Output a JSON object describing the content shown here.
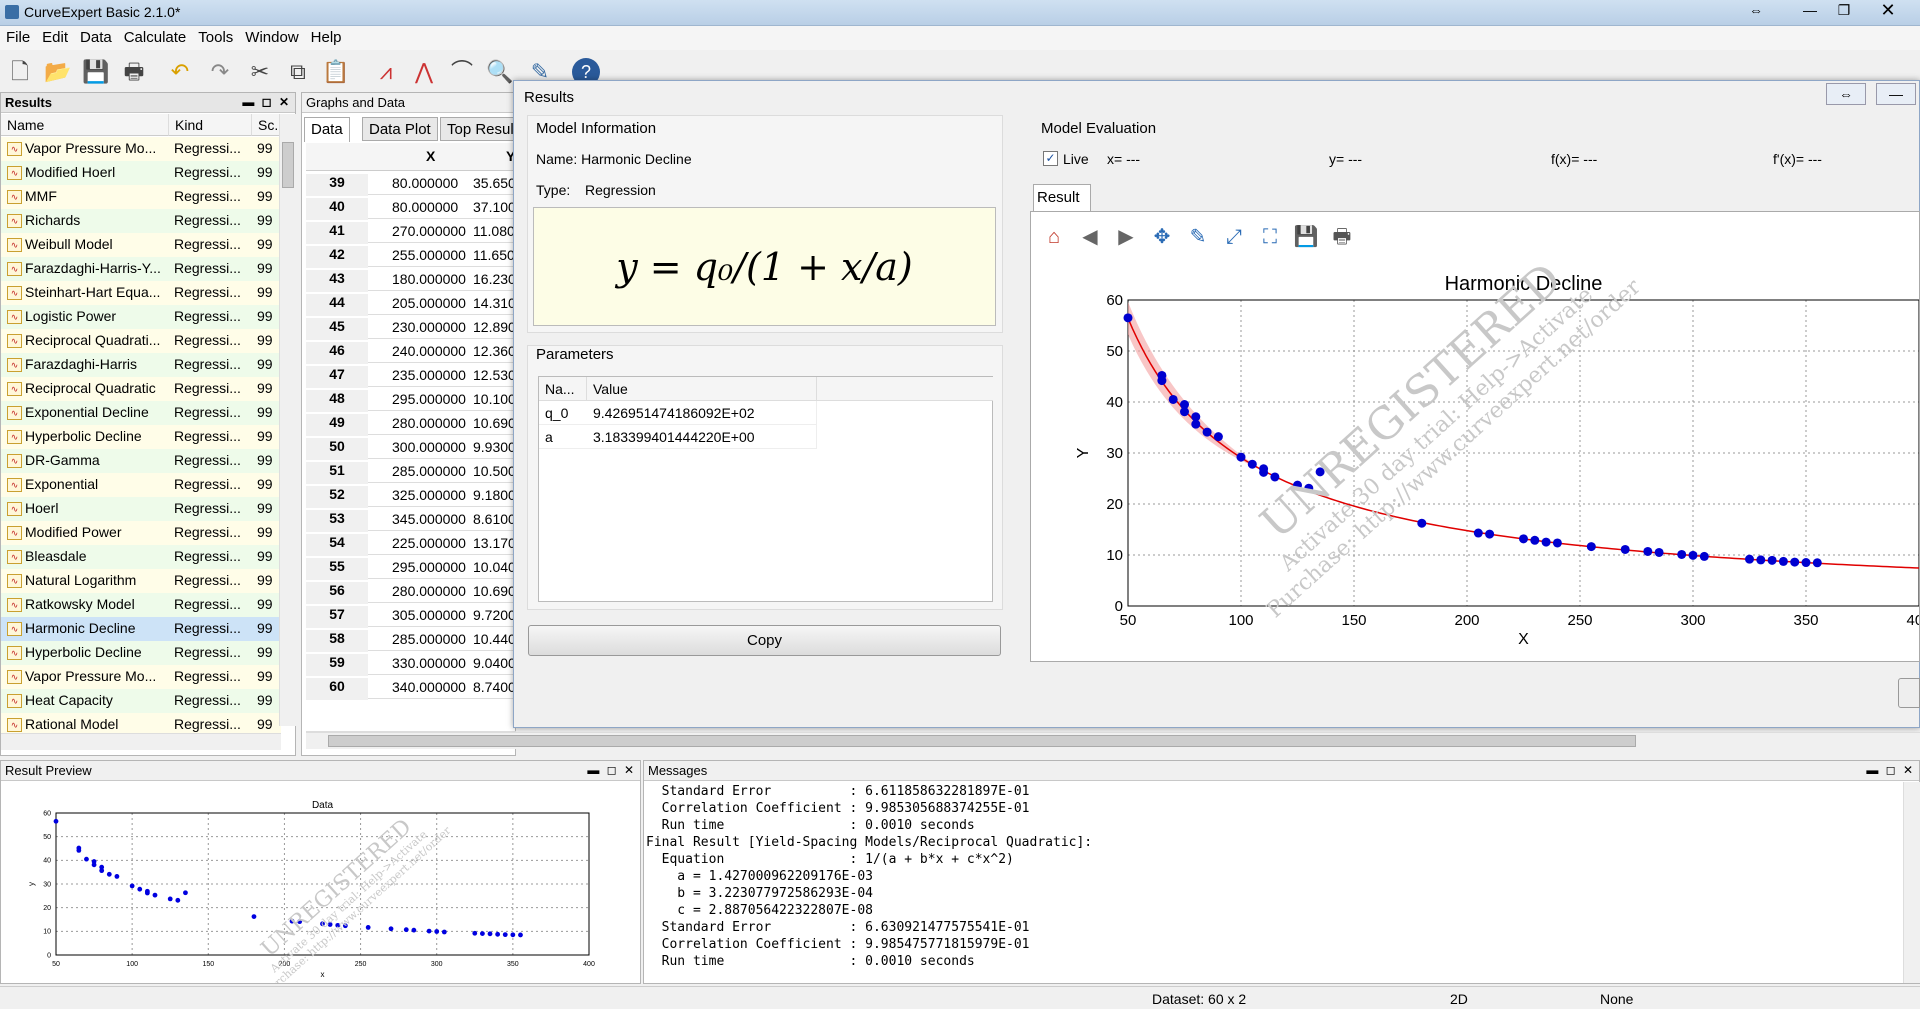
{
  "app": {
    "title": "CurveExpert Basic 2.1.0*"
  },
  "menu": [
    "File",
    "Edit",
    "Data",
    "Calculate",
    "Tools",
    "Window",
    "Help"
  ],
  "toolbar": [
    "new-icon",
    "open-icon",
    "save-icon",
    "print-icon",
    "undo-icon",
    "redo-icon",
    "cut-icon",
    "copy-icon",
    "paste-icon",
    "scatter-plot-icon",
    "line-plot-icon",
    "curve-plot-icon",
    "zoom-icon",
    "edit-icon",
    "help-icon"
  ],
  "left": {
    "title": "Results",
    "cols": [
      "Name",
      "Kind",
      "Sc."
    ],
    "rows": [
      {
        "name": "Vapor Pressure Mo...",
        "kind": "Regressi...",
        "sc": "99"
      },
      {
        "name": "Modified Hoerl",
        "kind": "Regressi...",
        "sc": "99"
      },
      {
        "name": "MMF",
        "kind": "Regressi...",
        "sc": "99"
      },
      {
        "name": "Richards",
        "kind": "Regressi...",
        "sc": "99"
      },
      {
        "name": "Weibull Model",
        "kind": "Regressi...",
        "sc": "99"
      },
      {
        "name": "Farazdaghi-Harris-Y...",
        "kind": "Regressi...",
        "sc": "99"
      },
      {
        "name": "Steinhart-Hart Equa...",
        "kind": "Regressi...",
        "sc": "99"
      },
      {
        "name": "Logistic Power",
        "kind": "Regressi...",
        "sc": "99"
      },
      {
        "name": "Reciprocal Quadrati...",
        "kind": "Regressi...",
        "sc": "99"
      },
      {
        "name": "Farazdaghi-Harris",
        "kind": "Regressi...",
        "sc": "99"
      },
      {
        "name": "Reciprocal Quadratic",
        "kind": "Regressi...",
        "sc": "99"
      },
      {
        "name": "Exponential Decline",
        "kind": "Regressi...",
        "sc": "99"
      },
      {
        "name": "Hyperbolic Decline",
        "kind": "Regressi...",
        "sc": "99"
      },
      {
        "name": "DR-Gamma",
        "kind": "Regressi...",
        "sc": "99"
      },
      {
        "name": "Exponential",
        "kind": "Regressi...",
        "sc": "99"
      },
      {
        "name": "Hoerl",
        "kind": "Regressi...",
        "sc": "99"
      },
      {
        "name": "Modified Power",
        "kind": "Regressi...",
        "sc": "99"
      },
      {
        "name": "Bleasdale",
        "kind": "Regressi...",
        "sc": "99"
      },
      {
        "name": "Natural Logarithm",
        "kind": "Regressi...",
        "sc": "99"
      },
      {
        "name": "Ratkowsky Model",
        "kind": "Regressi...",
        "sc": "99"
      },
      {
        "name": "Harmonic Decline",
        "kind": "Regressi...",
        "sc": "99"
      },
      {
        "name": "Hyperbolic Decline",
        "kind": "Regressi...",
        "sc": "99"
      },
      {
        "name": "Vapor Pressure Mo...",
        "kind": "Regressi...",
        "sc": "99"
      },
      {
        "name": "Heat Capacity",
        "kind": "Regressi...",
        "sc": "99"
      },
      {
        "name": "Rational Model",
        "kind": "Regressi...",
        "sc": "99"
      }
    ]
  },
  "graphs": {
    "title": "Graphs and Data",
    "tabs": [
      "Data",
      "Data Plot",
      "Top Result"
    ],
    "cols": [
      "X",
      "Y"
    ],
    "rows": [
      {
        "n": "39",
        "x": "80.000000",
        "y": "35.650"
      },
      {
        "n": "40",
        "x": "80.000000",
        "y": "37.100"
      },
      {
        "n": "41",
        "x": "270.000000",
        "y": "11.080"
      },
      {
        "n": "42",
        "x": "255.000000",
        "y": "11.650"
      },
      {
        "n": "43",
        "x": "180.000000",
        "y": "16.230"
      },
      {
        "n": "44",
        "x": "205.000000",
        "y": "14.310"
      },
      {
        "n": "45",
        "x": "230.000000",
        "y": "12.890"
      },
      {
        "n": "46",
        "x": "240.000000",
        "y": "12.360"
      },
      {
        "n": "47",
        "x": "235.000000",
        "y": "12.530"
      },
      {
        "n": "48",
        "x": "295.000000",
        "y": "10.100"
      },
      {
        "n": "49",
        "x": "280.000000",
        "y": "10.690"
      },
      {
        "n": "50",
        "x": "300.000000",
        "y": "9.9300"
      },
      {
        "n": "51",
        "x": "285.000000",
        "y": "10.500"
      },
      {
        "n": "52",
        "x": "325.000000",
        "y": "9.1800"
      },
      {
        "n": "53",
        "x": "345.000000",
        "y": "8.6100"
      },
      {
        "n": "54",
        "x": "225.000000",
        "y": "13.170"
      },
      {
        "n": "55",
        "x": "295.000000",
        "y": "10.040"
      },
      {
        "n": "56",
        "x": "280.000000",
        "y": "10.690"
      },
      {
        "n": "57",
        "x": "305.000000",
        "y": "9.7200"
      },
      {
        "n": "58",
        "x": "285.000000",
        "y": "10.440"
      },
      {
        "n": "59",
        "x": "330.000000",
        "y": "9.0400"
      },
      {
        "n": "60",
        "x": "340.000000",
        "y": "8.7400"
      }
    ]
  },
  "results": {
    "title": "Results",
    "model_info_title": "Model Information",
    "name_line": "Name: Harmonic Decline",
    "type_label": "Type:",
    "type_value": "Regression",
    "formula": "y = q₀/(1 + x/a)",
    "params_title": "Parameters",
    "param_cols": [
      "Na...",
      "Value"
    ],
    "params": [
      {
        "name": "q_0",
        "value": "9.426951474186092E+02"
      },
      {
        "name": "a",
        "value": "3.183399401444220E+00"
      }
    ],
    "copy": "Copy",
    "eval_title": "Model Evaluation",
    "live": "Live",
    "x_eval": "x= ---",
    "y_eval": "y= ---",
    "f_eval": "f(x)= ---",
    "fp_eval": "f'(x)= ---",
    "result_tab": "Result"
  },
  "plot_toolbar": [
    "home-icon",
    "back-icon",
    "forward-icon",
    "pan-icon",
    "edit-axes-icon",
    "fit-icon",
    "zoom-rect-icon",
    "save-figure-icon",
    "print-figure-icon"
  ],
  "preview": {
    "title": "Result Preview"
  },
  "messages": {
    "title": "Messages",
    "text": "  Standard Error          : 6.611858632281897E-01\n  Correlation Coefficient : 9.985305688374255E-01\n  Run time                : 0.0010 seconds\nFinal Result [Yield-Spacing Models/Reciprocal Quadratic]:\n  Equation                : 1/(a + b*x + c*x^2)\n    a = 1.427000962209176E-03\n    b = 3.223077972586293E-04\n    c = 2.887056422322807E-08\n  Standard Error          : 6.630921477575541E-01\n  Correlation Coefficient : 9.985475771815979E-01\n  Run time                : 0.0010 seconds"
  },
  "status": {
    "dataset": "Dataset: 60 x 2",
    "dim": "2D",
    "sel": "None"
  },
  "watermark": {
    "line1": "UNREGISTERED",
    "line2": "Activate 30 day trial: Help->Activate",
    "line3": "Purchase: http://www.curveexpert.net/order"
  },
  "chart_data": [
    {
      "type": "scatter",
      "title": "Harmonic Decline",
      "xlabel": "X",
      "ylabel": "Y",
      "xlim": [
        50,
        400
      ],
      "ylim": [
        0,
        60
      ],
      "xticks": [
        50,
        100,
        150,
        200,
        250,
        300,
        350,
        400
      ],
      "yticks": [
        0,
        10,
        20,
        30,
        40,
        50,
        60
      ],
      "grid": true,
      "points": [
        [
          50,
          56.5
        ],
        [
          65,
          45.2
        ],
        [
          65,
          44.2
        ],
        [
          70,
          40.5
        ],
        [
          75,
          39.5
        ],
        [
          75,
          38.1
        ],
        [
          80,
          37.1
        ],
        [
          80,
          35.65
        ],
        [
          85,
          34.1
        ],
        [
          90,
          33.2
        ],
        [
          100,
          29.2
        ],
        [
          105,
          27.8
        ],
        [
          110,
          26.9
        ],
        [
          110,
          26.2
        ],
        [
          115,
          25.3
        ],
        [
          125,
          23.7
        ],
        [
          130,
          23.1
        ],
        [
          135,
          26.3
        ],
        [
          180,
          16.23
        ],
        [
          205,
          14.31
        ],
        [
          210,
          14.1
        ],
        [
          225,
          13.17
        ],
        [
          230,
          12.89
        ],
        [
          235,
          12.53
        ],
        [
          240,
          12.36
        ],
        [
          255,
          11.65
        ],
        [
          270,
          11.08
        ],
        [
          280,
          10.69
        ],
        [
          285,
          10.5
        ],
        [
          295,
          10.1
        ],
        [
          300,
          9.93
        ],
        [
          305,
          9.72
        ],
        [
          325,
          9.18
        ],
        [
          330,
          9.04
        ],
        [
          335,
          8.95
        ],
        [
          340,
          8.74
        ],
        [
          345,
          8.61
        ],
        [
          350,
          8.52
        ],
        [
          355,
          8.47
        ]
      ],
      "fit": {
        "q0": 942.6951474186092,
        "a": 3.18339940144422
      }
    },
    {
      "type": "scatter",
      "title": "Data",
      "xlabel": "x",
      "ylabel": "y",
      "xlim": [
        50,
        400
      ],
      "ylim": [
        0,
        60
      ],
      "xticks": [
        50,
        100,
        150,
        200,
        250,
        300,
        350,
        400
      ],
      "yticks": [
        0,
        10,
        20,
        30,
        40,
        50,
        60
      ]
    }
  ]
}
